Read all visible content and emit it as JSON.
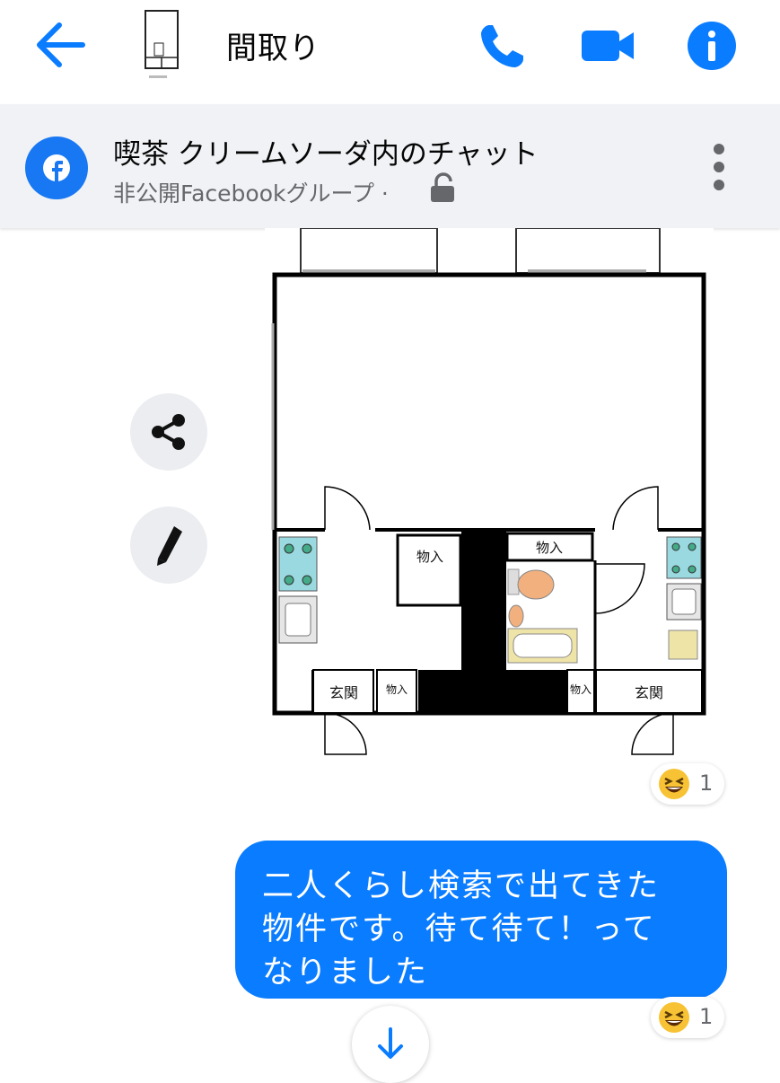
{
  "header": {
    "title": "間取り",
    "back_icon": "arrow-left-icon",
    "call_icon": "phone-icon",
    "video_icon": "video-camera-icon",
    "info_icon": "info-icon",
    "accent_color": "#0a7cff"
  },
  "banner": {
    "group_name": "喫茶 クリームソーダ内のチャット",
    "group_subtitle": "非公開Facebookグループ ·",
    "lock_icon": "unlocked-padlock-icon",
    "more_icon": "vertical-dots-icon"
  },
  "floorplan": {
    "storage_left": "物入",
    "storage_top_right": "物入",
    "storage_small_left": "物入",
    "storage_small_right": "物入",
    "entrance_left": "玄関",
    "entrance_right": "玄関"
  },
  "side_actions": {
    "share_icon": "share-icon",
    "edit_icon": "pencil-icon"
  },
  "image_reaction": {
    "emoji": "grinning-squinting-face",
    "count": "1"
  },
  "message": {
    "line1": "二人くらし検索で出てきた",
    "line2": "物件です。待て待て！って",
    "line3": "なりました",
    "bubble_color": "#0a7cff"
  },
  "message_reaction": {
    "emoji": "grinning-squinting-face",
    "count": "1"
  },
  "scroll_down_icon": "arrow-down-icon"
}
